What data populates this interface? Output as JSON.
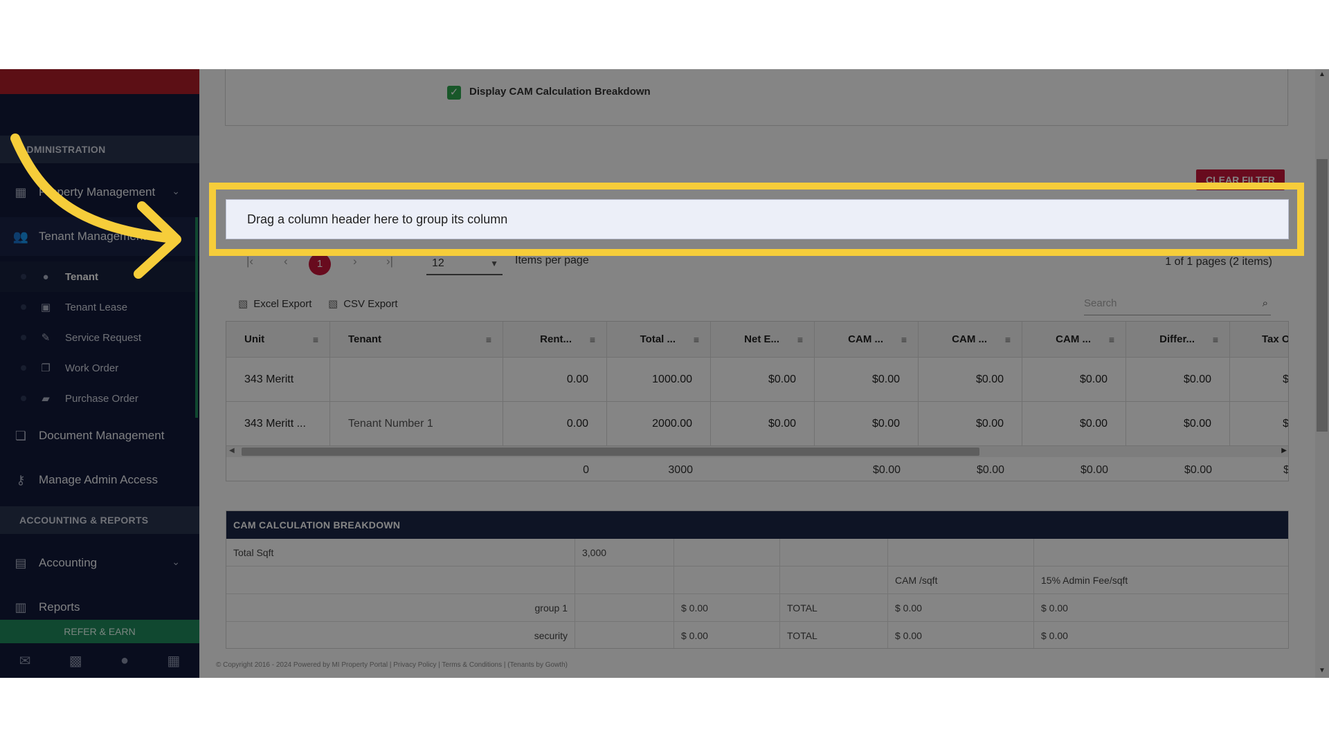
{
  "sidebar": {
    "section_admin": "ADMINISTRATION",
    "property_mgmt": "Property Management",
    "tenant_mgmt": "Tenant Management",
    "sub_items": [
      {
        "label": "Tenant",
        "icon": "person-icon"
      },
      {
        "label": "Tenant Lease",
        "icon": "calendar-icon"
      },
      {
        "label": "Service Request",
        "icon": "wrench-icon"
      },
      {
        "label": "Work Order",
        "icon": "copy-icon"
      },
      {
        "label": "Purchase Order",
        "icon": "truck-icon"
      }
    ],
    "document_mgmt": "Document Management",
    "manage_admin": "Manage Admin Access",
    "section_accounting": "ACCOUNTING & REPORTS",
    "accounting": "Accounting",
    "reports": "Reports",
    "refer": "REFER & EARN"
  },
  "top": {
    "checkbox_label": "Display CAM Calculation Breakdown",
    "checkbox_checked": true
  },
  "clear_filter": "CLEAR FILTER",
  "group_drop": "Drag a column header here to group its column",
  "pager": {
    "current_page": "1",
    "per_page": "12",
    "per_page_label": "Items per page",
    "info": "1 of 1 pages (2 items)"
  },
  "exports": {
    "excel": "Excel Export",
    "csv": "CSV Export",
    "search_placeholder": "Search"
  },
  "grid": {
    "headers": [
      "Unit",
      "Tenant",
      "Rent...",
      "Total ...",
      "Net E...",
      "CAM ...",
      "CAM ...",
      "CAM ...",
      "Differ...",
      "Tax O"
    ],
    "rows": [
      [
        "343 Meritt",
        "",
        "0.00",
        "1000.00",
        "$0.00",
        "$0.00",
        "$0.00",
        "$0.00",
        "$0.00",
        "$"
      ],
      [
        "343 Meritt ...",
        "Tenant Number 1",
        "0.00",
        "2000.00",
        "$0.00",
        "$0.00",
        "$0.00",
        "$0.00",
        "$0.00",
        "$"
      ]
    ],
    "footer": [
      "0",
      "3000",
      "$0.00",
      "$0.00",
      "$0.00",
      "$0.00",
      "$"
    ]
  },
  "cam": {
    "title": "CAM CALCULATION BREAKDOWN",
    "total_sqft_label": "Total Sqft",
    "total_sqft_value": "3,000",
    "col_cam_sqft": "CAM /sqft",
    "col_admin_fee": "15% Admin Fee/sqft",
    "rows": [
      {
        "name": "group 1",
        "amount": "$ 0.00",
        "total": "TOTAL",
        "cam": "$ 0.00",
        "fee": "$ 0.00"
      },
      {
        "name": "security",
        "amount": "$ 0.00",
        "total": "TOTAL",
        "cam": "$ 0.00",
        "fee": "$ 0.00"
      }
    ]
  },
  "footer": {
    "copyright": "© Copyright 2016 - 2024 Powered by MI Property Portal | Privacy Policy | Terms & Conditions | (Tenants by Gowth)"
  },
  "colors": {
    "highlight": "#f6cd3a",
    "brand_red": "#c8163a",
    "sidebar_bg": "#12193a",
    "accent_green": "#1f8a5c"
  }
}
